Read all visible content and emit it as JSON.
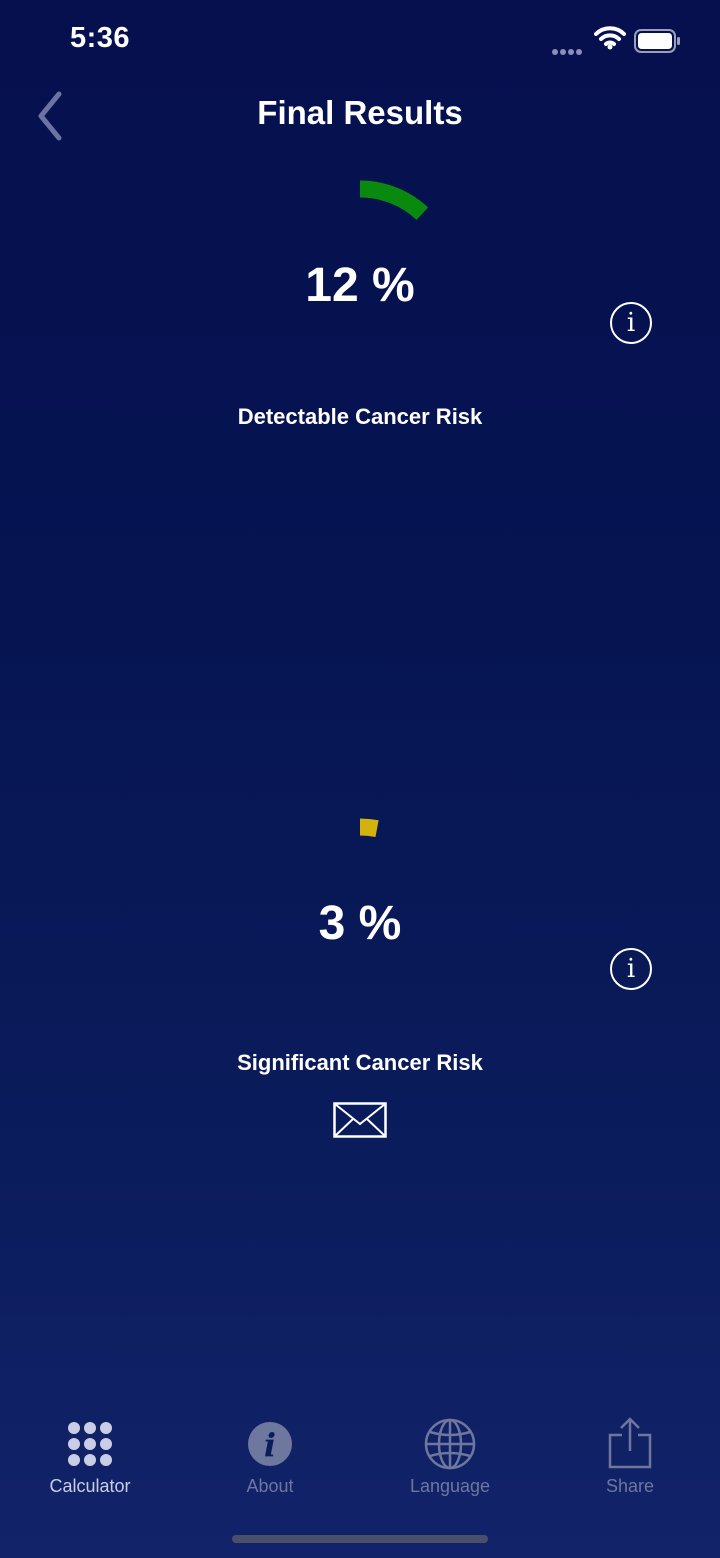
{
  "status_bar": {
    "time": "5:36",
    "icons": [
      "signal-dots-icon",
      "wifi-icon",
      "battery-icon"
    ]
  },
  "nav": {
    "title": "Final Results",
    "back_icon": "chevron-left-icon"
  },
  "results": [
    {
      "value_text": "12 %",
      "percent": 12,
      "label": "Detectable Cancer Risk",
      "color": "#098a0f",
      "info_glyph": "i"
    },
    {
      "value_text": "3 %",
      "percent": 3,
      "label": "Significant Cancer Risk",
      "color": "#d4b20e",
      "info_glyph": "i"
    }
  ],
  "mail_icon": "envelope-icon",
  "tabs": [
    {
      "label": "Calculator",
      "icon": "grid-dots-icon",
      "active": true
    },
    {
      "label": "About",
      "icon": "info-icon",
      "active": false
    },
    {
      "label": "Language",
      "icon": "globe-icon",
      "active": false
    },
    {
      "label": "Share",
      "icon": "share-icon",
      "active": false
    }
  ],
  "colors": {
    "background_top": "#06104f",
    "background_bottom": "#12236a",
    "tab_active": "#c9cde6",
    "tab_inactive": "#6e779e"
  }
}
